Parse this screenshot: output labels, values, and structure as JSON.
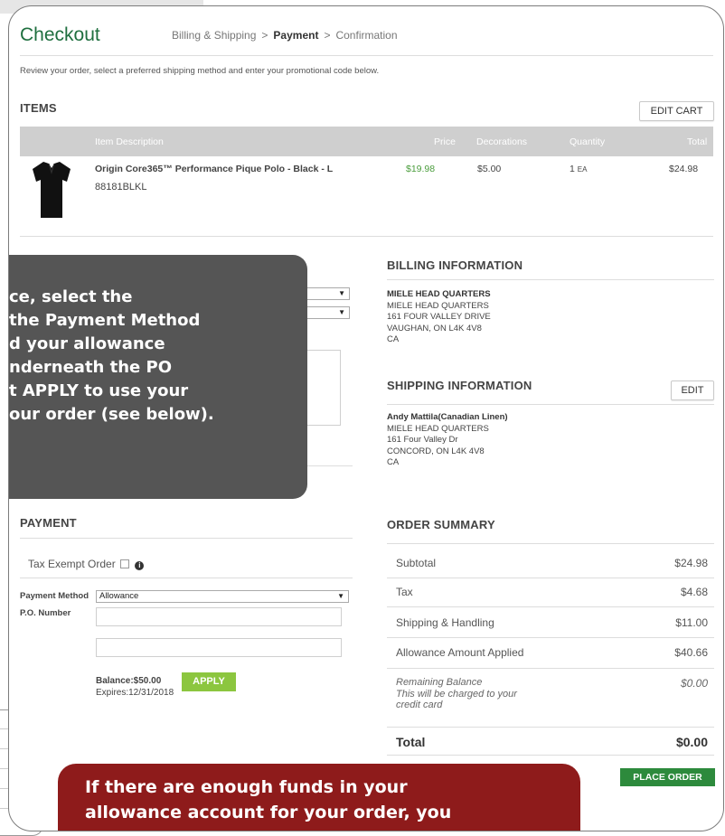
{
  "header": {
    "title": "Checkout",
    "breadcrumb": [
      "Billing & Shipping",
      ">",
      "Payment",
      ">",
      "Confirmation"
    ],
    "intro": "Review your order, select a preferred shipping method and enter your promotional code below."
  },
  "items": {
    "heading": "ITEMS",
    "edit_cart_label": "EDIT CART",
    "columns": [
      "Item Description",
      "Price",
      "Decorations",
      "Quantity",
      "Total"
    ],
    "rows": [
      {
        "description": "Origin Core365™ Performance Pique Polo - Black - L",
        "sku": "88181BLKL",
        "price": "$19.98",
        "decorations": "$5.00",
        "quantity": "1",
        "unit": "EA",
        "total": "$24.98"
      }
    ]
  },
  "billing": {
    "heading": "BILLING INFORMATION",
    "lines": [
      "MIELE HEAD QUARTERS",
      "MIELE HEAD QUARTERS",
      "161 FOUR VALLEY DRIVE",
      "VAUGHAN, ON L4K 4V8",
      "CA"
    ]
  },
  "shipping": {
    "heading": "SHIPPING INFORMATION",
    "edit_label": "EDIT",
    "lines": [
      "Andy Mattila(Canadian Linen)",
      "MIELE HEAD QUARTERS",
      "161 Four Valley Dr",
      "CONCORD, ON L4K 4V8",
      "CA"
    ]
  },
  "payment": {
    "heading": "PAYMENT",
    "tax_exempt_label": "Tax Exempt Order",
    "payment_method_label": "Payment Method",
    "payment_method_value": "Allowance",
    "po_label": "P.O. Number",
    "balance": "Balance:$50.00",
    "expires": "Expires:12/31/2018",
    "apply_label": "APPLY"
  },
  "order_summary": {
    "heading": "ORDER SUMMARY",
    "rows": [
      {
        "label": "Subtotal",
        "value": "$24.98"
      },
      {
        "label": "Tax",
        "value": "$4.68"
      },
      {
        "label": "Shipping & Handling",
        "value": "$11.00"
      },
      {
        "label": "Allowance Amount Applied",
        "value": "$40.66"
      }
    ],
    "remaining_label": "Remaining Balance",
    "remaining_note_1": "This will be charged to your",
    "remaining_note_2": "credit card",
    "remaining_value": "$0.00",
    "total_label": "Total",
    "total_value": "$0.00",
    "place_order_label": "PLACE ORDER"
  },
  "tooltip_dark": {
    "line1_a": "ce, select the",
    "line2_a": "the Payment Method",
    "line3_a": "d your allowance",
    "line4_a": "nderneath the PO",
    "line5_a": "t ",
    "line5_b": "APPLY",
    "line5_c": " to use your",
    "line6_a": "our order (see below)."
  },
  "tooltip_red": {
    "line1": "If there are enough funds in your",
    "line2": "allowance account for your order, you"
  },
  "colors": {
    "title_green": "#1f6f3f",
    "price_green": "#4a9d3c",
    "apply_button": "#8cc63f",
    "place_order_button": "#2d8a3c",
    "tooltip_dark": "#555555",
    "tooltip_red": "#8e1b1b",
    "table_header": "#cfcfcf"
  }
}
